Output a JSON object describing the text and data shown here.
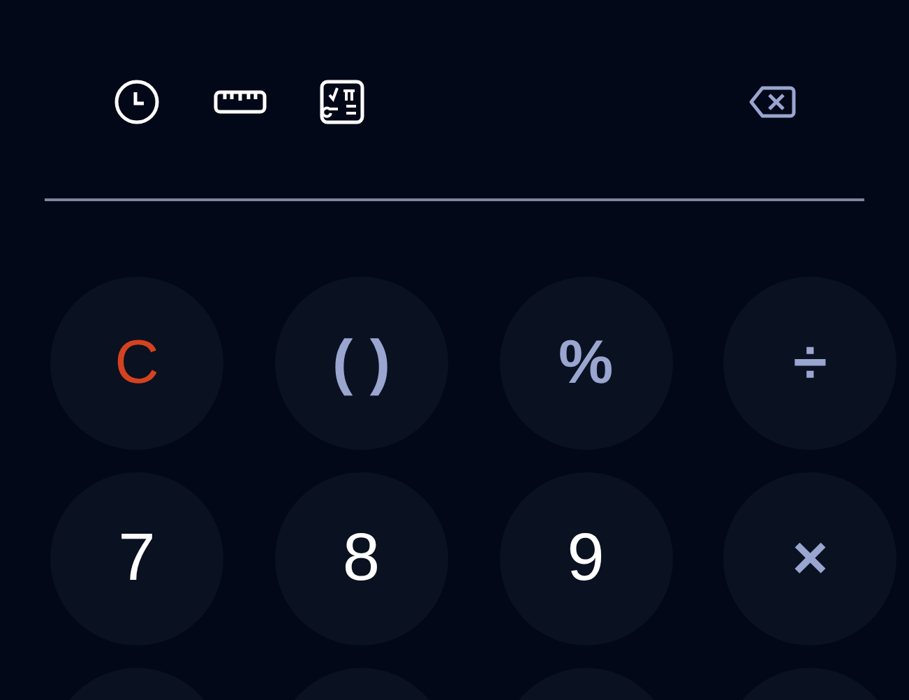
{
  "toolbar": [
    {
      "kind": "history"
    },
    {
      "kind": "converter"
    },
    {
      "kind": "scientific"
    },
    {
      "kind": "spacer"
    },
    {
      "kind": "backspace"
    }
  ],
  "keys": [
    {
      "label": "C",
      "kind": "clear"
    },
    {
      "label": "( )",
      "kind": "operator"
    },
    {
      "label": "%",
      "kind": "operator"
    },
    {
      "label": "÷",
      "kind": "operator"
    },
    {
      "label": "7",
      "kind": "digit"
    },
    {
      "label": "8",
      "kind": "digit"
    },
    {
      "label": "9",
      "kind": "digit"
    },
    {
      "label": "×",
      "kind": "operator"
    },
    {
      "kind": "cut"
    },
    {
      "kind": "cut"
    },
    {
      "kind": "cut"
    },
    {
      "kind": "cut"
    }
  ]
}
